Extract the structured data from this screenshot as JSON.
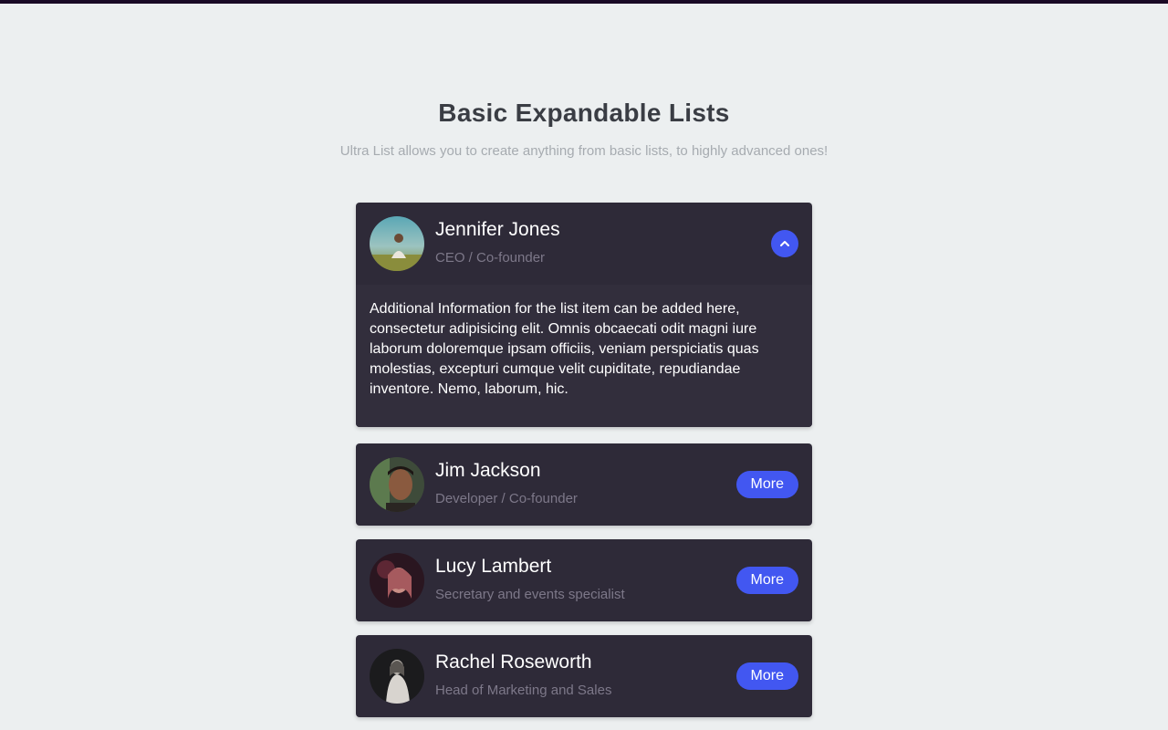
{
  "header": {
    "title": "Basic Expandable Lists",
    "subtitle": "Ultra List allows you to create anything from basic lists, to highly advanced ones!"
  },
  "colors": {
    "background": "#eceff0",
    "card": "#2e2a38",
    "accent": "#4257f1",
    "title": "#3a3d44",
    "subtitle": "#a6abb0",
    "role": "#7d7889"
  },
  "list": {
    "items": [
      {
        "name": "Jennifer Jones",
        "role": "CEO / Co-founder",
        "expanded": true,
        "toggle_icon": "chevron-up-icon",
        "details": "Additional Information for the list item can be added here, consectetur adipisicing elit. Omnis obcaecati odit magni iure laborum doloremque ipsam officiis, veniam perspiciatis quas molestias, excepturi cumque velit cupiditate, repudiandae inventore. Nemo, laborum, hic."
      },
      {
        "name": "Jim Jackson",
        "role": "Developer / Co-founder",
        "expanded": false,
        "button_label": "More"
      },
      {
        "name": "Lucy Lambert",
        "role": "Secretary and events specialist",
        "expanded": false,
        "button_label": "More"
      },
      {
        "name": "Rachel Roseworth",
        "role": "Head of Marketing and Sales",
        "expanded": false,
        "button_label": "More"
      }
    ]
  }
}
